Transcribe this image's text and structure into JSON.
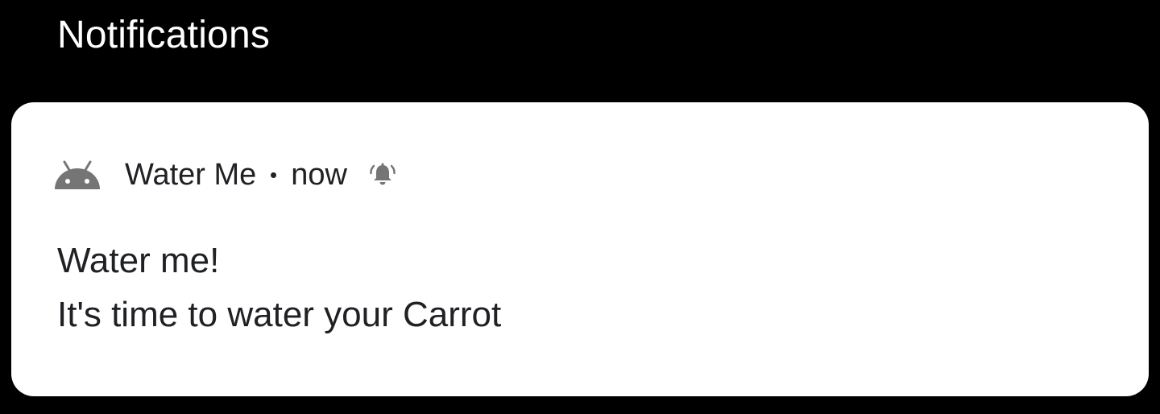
{
  "section": {
    "title": "Notifications"
  },
  "notification": {
    "app_name": "Water Me",
    "timestamp": "now",
    "title": "Water me!",
    "text": "It's time to water your Carrot",
    "icons": {
      "app": "android-robot-icon",
      "alert": "bell-alert-icon"
    },
    "colors": {
      "card_background": "#ffffff",
      "text": "#202124",
      "icon": "#757575",
      "screen_background": "#000000"
    }
  }
}
